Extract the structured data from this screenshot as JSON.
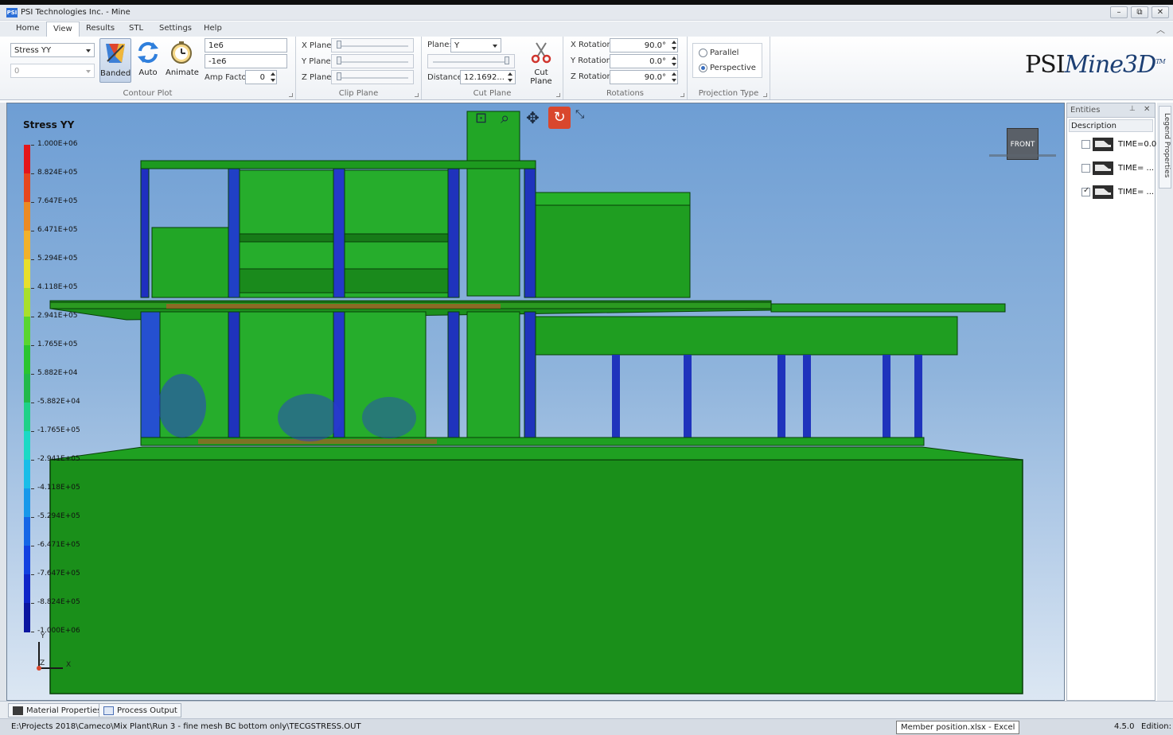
{
  "window": {
    "title": "PSI Technologies Inc. - Mine",
    "icon": "PSI",
    "min": "–",
    "max": "⧉",
    "close": "✕"
  },
  "menu": [
    "Home",
    "View",
    "Results",
    "STL",
    "Settings",
    "Help"
  ],
  "ribbon": {
    "contour": {
      "group_label": "Contour Plot",
      "result_combo": "Stress YY",
      "secondary_combo": "0",
      "banded": "Banded",
      "auto": "Auto",
      "animate": "Animate",
      "max_value": "1e6",
      "min_value": "-1e6",
      "amp_label": "Amp Factor",
      "amp_value": "0"
    },
    "clip": {
      "group_label": "Clip Plane",
      "x": "X Plane:",
      "y": "Y Plane:",
      "z": "Z Plane:"
    },
    "cut": {
      "group_label": "Cut Plane",
      "plane_label": "Plane:",
      "plane_value": "Y",
      "distance_label": "Distance:",
      "distance_value": "12.1692...",
      "button": "Cut Plane"
    },
    "rotations": {
      "group_label": "Rotations",
      "x_label": "X Rotation:",
      "x_value": "90.0°",
      "y_label": "Y Rotation:",
      "y_value": "0.0°",
      "z_label": "Z Rotation:",
      "z_value": "90.0°"
    },
    "projection": {
      "group_label": "Projection Type",
      "parallel": "Parallel",
      "perspective": "Perspective",
      "selected": "Perspective"
    }
  },
  "logo": {
    "psi": "PSI",
    "mine": "Mine3D",
    "tm": "TM"
  },
  "viewport": {
    "legend_title": "Stress YY",
    "legend_values": [
      "1.000E+06",
      "8.824E+05",
      "7.647E+05",
      "6.471E+05",
      "5.294E+05",
      "4.118E+05",
      "2.941E+05",
      "1.765E+05",
      "5.882E+04",
      "-5.882E+04",
      "-1.765E+05",
      "-2.941E+05",
      "-4.118E+05",
      "-5.294E+05",
      "-6.471E+05",
      "-7.647E+05",
      "-8.824E+05",
      "-1.000E+06"
    ],
    "legend_colors": [
      "#e4161b",
      "#e6471e",
      "#ec8a24",
      "#f2b12a",
      "#e8df2c",
      "#a9df2c",
      "#59d52f",
      "#2ac52f",
      "#22b94a",
      "#1fd188",
      "#1cd9c5",
      "#19bde8",
      "#1798ea",
      "#1566e6",
      "#1241e0",
      "#0f25c8",
      "#0b16a0"
    ],
    "nav_cube": "FRONT",
    "axis_x": "X",
    "axis_y": "Y",
    "axis_z": "Z"
  },
  "entities": {
    "title": "Entities",
    "column": "Description",
    "rows": [
      {
        "label": "TIME=0.0",
        "checked": false
      },
      {
        "label": "TIME= ...",
        "checked": false
      },
      {
        "label": "TIME= ...",
        "checked": true
      }
    ]
  },
  "side_tab": "Legend Properties",
  "bottom_tabs": [
    "Material Properties",
    "Process Output"
  ],
  "status": {
    "path": "E:\\Projects 2018\\Cameco\\Mix Plant\\Run 3 - fine mesh BC bottom only\\TECGSTRESS.OUT",
    "tooltip": "Member position.xlsx - Excel",
    "version": "4.5.0",
    "edition": "Edition:"
  }
}
